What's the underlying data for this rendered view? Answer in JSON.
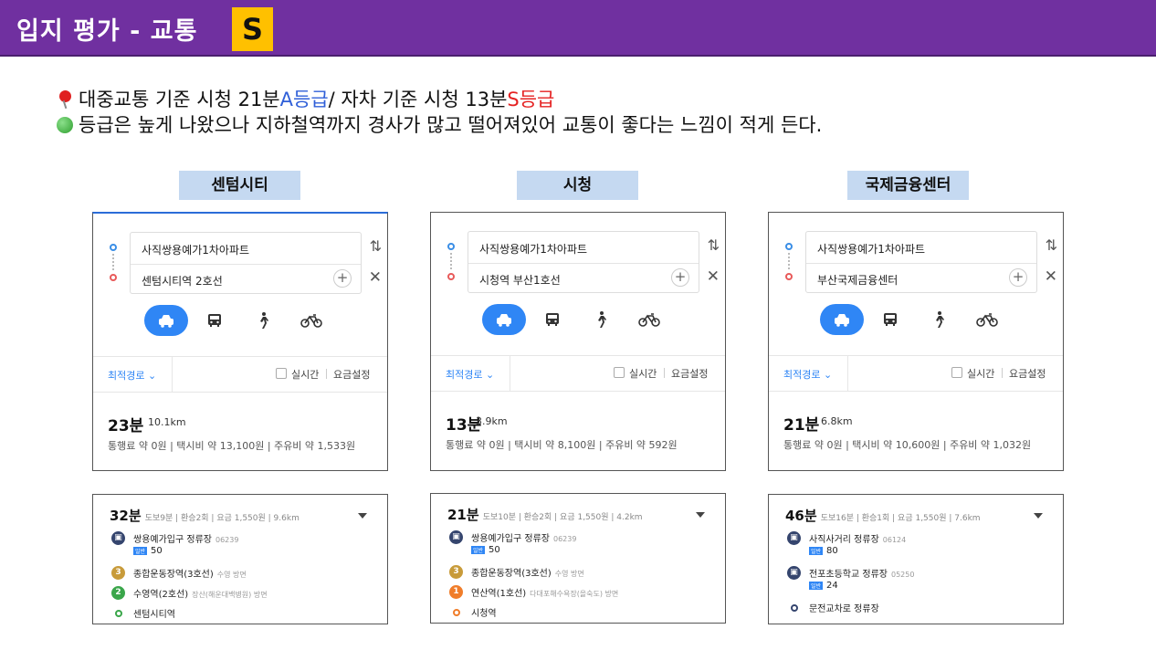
{
  "header": {
    "title": "입지 평가 - 교통",
    "grade": "S"
  },
  "summary": {
    "line1": {
      "part1": "대중교통 기준 시청 21분 ",
      "grade1": "A등급",
      "part2": " / 자차 기준 시청 13분 ",
      "grade2": "S등급"
    },
    "line2": "등급은 높게 나왔으나 지하철역까지 경사가 많고 떨어져있어 교통이 좋다는 느낌이 적게 든다."
  },
  "columns": [
    {
      "label": "센텀시티",
      "origin": "사직쌍용예가1차아파트",
      "destination": "센텀시티역 2호선",
      "route_option": "최적경로 ⌄",
      "realtime": "실시간",
      "fare_setting": "요금설정",
      "time": "23분",
      "distance": "10.1km",
      "costs": "통행료 약 0원 | 택시비 약 13,100원 | 주유비 약 1,533원",
      "transit": {
        "time": "32분",
        "meta": "도보9분 | 환승2회 | 요금 1,550원 | 9.6km",
        "steps": [
          {
            "name": "쌍용예가입구 정류장",
            "sub": "06239",
            "icon": "bus",
            "bus_tag": "일반",
            "bus_no": "50"
          },
          {
            "name": "종합운동장역(3호선)",
            "sub": "수영 방면",
            "icon": "3"
          },
          {
            "name": "수영역(2호선)",
            "sub": "장산(해운대백병원) 방면",
            "icon": "2"
          },
          {
            "name": "센텀시티역",
            "sub": "",
            "icon": "end"
          }
        ]
      }
    },
    {
      "label": "시청",
      "origin": "사직쌍용예가1차아파트",
      "destination": "시청역 부산1호선",
      "route_option": "최적경로 ⌄",
      "realtime": "실시간",
      "fare_setting": "요금설정",
      "time": "13분",
      "distance": "3.9km",
      "costs": "통행료 약 0원 | 택시비 약 8,100원 | 주유비 약 592원",
      "transit": {
        "time": "21분",
        "meta": "도보10분 | 환승2회 | 요금 1,550원 | 4.2km",
        "steps": [
          {
            "name": "쌍용예가입구 정류장",
            "sub": "06239",
            "icon": "bus",
            "bus_tag": "일반",
            "bus_no": "50"
          },
          {
            "name": "종합운동장역(3호선)",
            "sub": "수영 방면",
            "icon": "3"
          },
          {
            "name": "연산역(1호선)",
            "sub": "다대포해수욕장(을숙도) 방면",
            "icon": "1"
          },
          {
            "name": "시청역",
            "sub": "",
            "icon": "end"
          }
        ]
      }
    },
    {
      "label": "국제금융센터",
      "origin": "사직쌍용예가1차아파트",
      "destination": "부산국제금융센터",
      "route_option": "최적경로 ⌄",
      "realtime": "실시간",
      "fare_setting": "요금설정",
      "time": "21분",
      "distance": "6.8km",
      "costs": "통행료 약 0원 | 택시비 약 10,600원 | 주유비 약 1,032원",
      "transit": {
        "time": "46분",
        "meta": "도보16분 | 환승1회 | 요금 1,550원 | 7.6km",
        "steps": [
          {
            "name": "사직사거리 정류장",
            "sub": "06124",
            "icon": "bus",
            "bus_tag": "일반",
            "bus_no": "80"
          },
          {
            "name": "전포초등학교 정류장",
            "sub": "05250",
            "icon": "bus",
            "bus_tag": "일반",
            "bus_no": "24"
          },
          {
            "name": "문전교차로 정류장",
            "sub": "",
            "icon": "end"
          }
        ]
      }
    }
  ],
  "icons": {
    "pin": "pushpin-icon",
    "green_dot": "green-circle-icon",
    "swap": "swap-icon",
    "close": "close-icon",
    "plus": "plus-icon",
    "car": "car-icon",
    "bus": "bus-icon",
    "walk": "walk-icon",
    "bike": "bicycle-icon"
  },
  "colors": {
    "header_bg": "#7030a0",
    "grade_badge": "#ffc000",
    "label_bg": "#c5d9f1",
    "accent_blue": "#2f86f5",
    "grade_a": "#2f5fd8",
    "grade_s": "#e52222"
  }
}
